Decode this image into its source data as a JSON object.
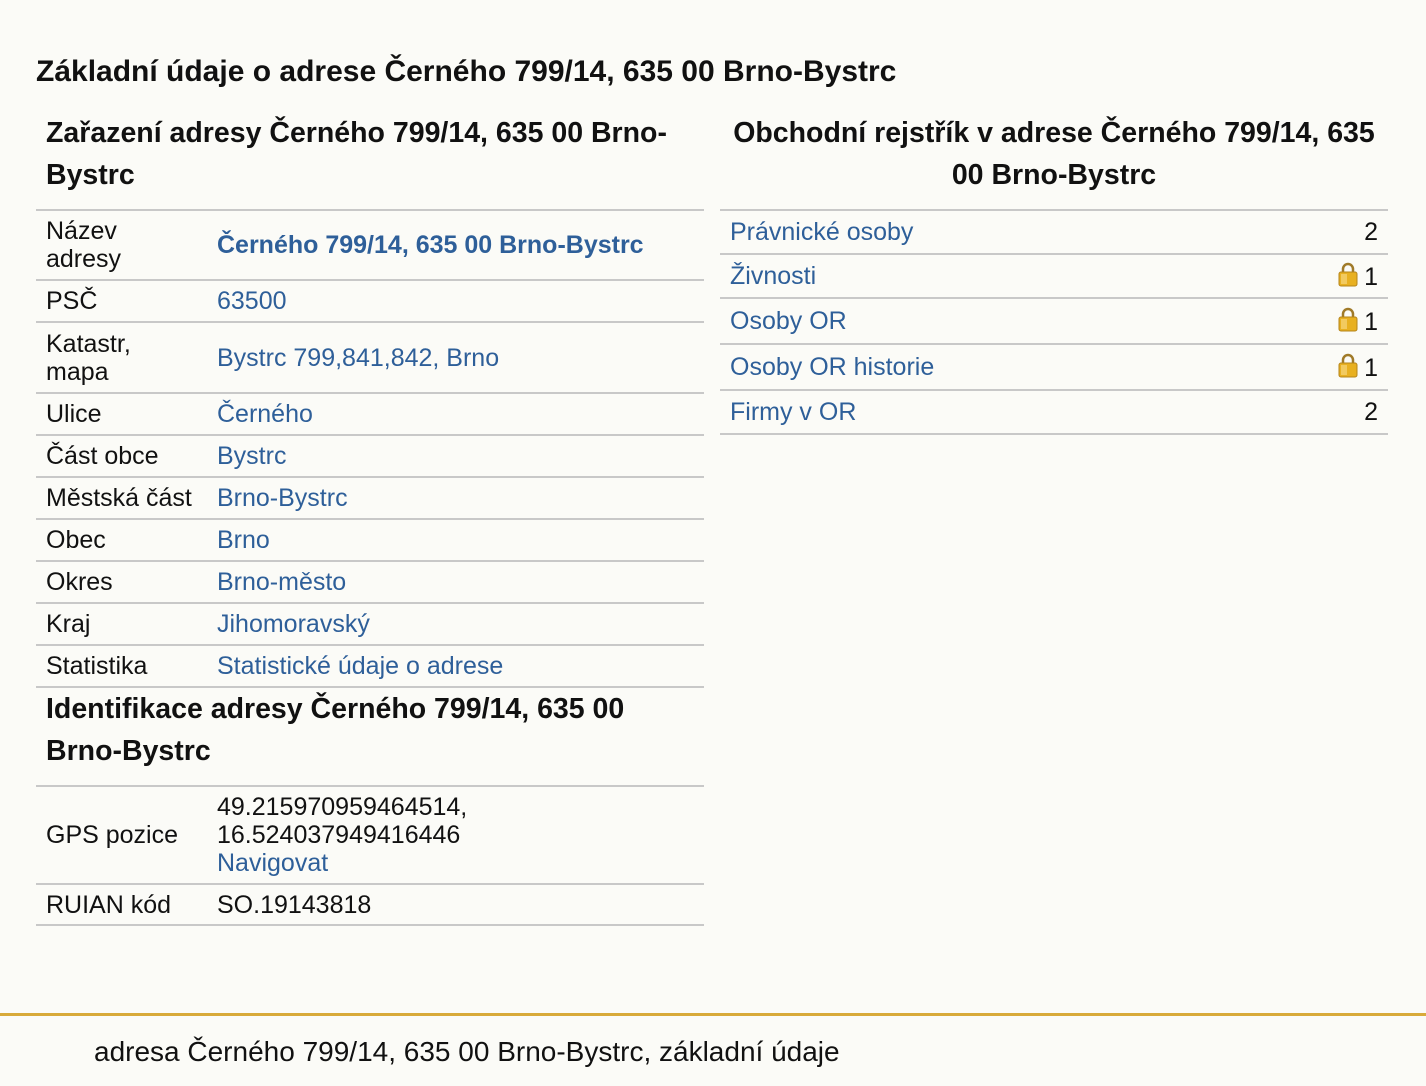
{
  "page": {
    "title": "Základní údaje o adrese Černého 799/14, 635 00 Brno-Bystrc",
    "footer": "adresa Černého 799/14, 635 00 Brno-Bystrc, základní údaje"
  },
  "zarazeni": {
    "title": "Zařazení adresy Černého 799/14, 635 00 Brno-Bystrc",
    "rows": [
      {
        "label": "Název adresy",
        "value": "Černého 799/14, 635 00 Brno-Bystrc"
      },
      {
        "label": "PSČ",
        "value": "63500"
      },
      {
        "label": "Katastr, mapa",
        "value": "Bystrc 799,841,842, Brno"
      },
      {
        "label": "Ulice",
        "value": "Černého"
      },
      {
        "label": "Část obce",
        "value": "Bystrc"
      },
      {
        "label": "Městská část",
        "value": "Brno-Bystrc"
      },
      {
        "label": "Obec",
        "value": "Brno"
      },
      {
        "label": "Okres",
        "value": "Brno-město"
      },
      {
        "label": "Kraj",
        "value": "Jihomoravský"
      },
      {
        "label": "Statistika",
        "value": "Statistické údaje o adrese"
      }
    ]
  },
  "identifikace": {
    "title": "Identifikace adresy Černého 799/14, 635 00 Brno-Bystrc",
    "gps_label": "GPS pozice",
    "gps_lat": "49.215970959464514,",
    "gps_lon": "16.524037949416446",
    "gps_link": "Navigovat",
    "ruian_label": "RUIAN kód",
    "ruian_value": "SO.19143818"
  },
  "rejstrik": {
    "title": "Obchodní rejstřík v adrese Černého 799/14, 635 00 Brno-Bystrc",
    "rows": [
      {
        "label": "Právnické osoby",
        "count": "2",
        "locked": false
      },
      {
        "label": "Živnosti",
        "count": "1",
        "locked": true
      },
      {
        "label": "Osoby OR",
        "count": "1",
        "locked": true
      },
      {
        "label": "Osoby OR historie",
        "count": "1",
        "locked": true
      },
      {
        "label": "Firmy v OR",
        "count": "2",
        "locked": false
      }
    ]
  },
  "icons": {
    "lock": "lock-icon"
  },
  "colors": {
    "link": "#2e5f99",
    "footer_bar": "#d8aa3a",
    "background": "#fbfbf7",
    "lock_gold": "#e8b020"
  }
}
